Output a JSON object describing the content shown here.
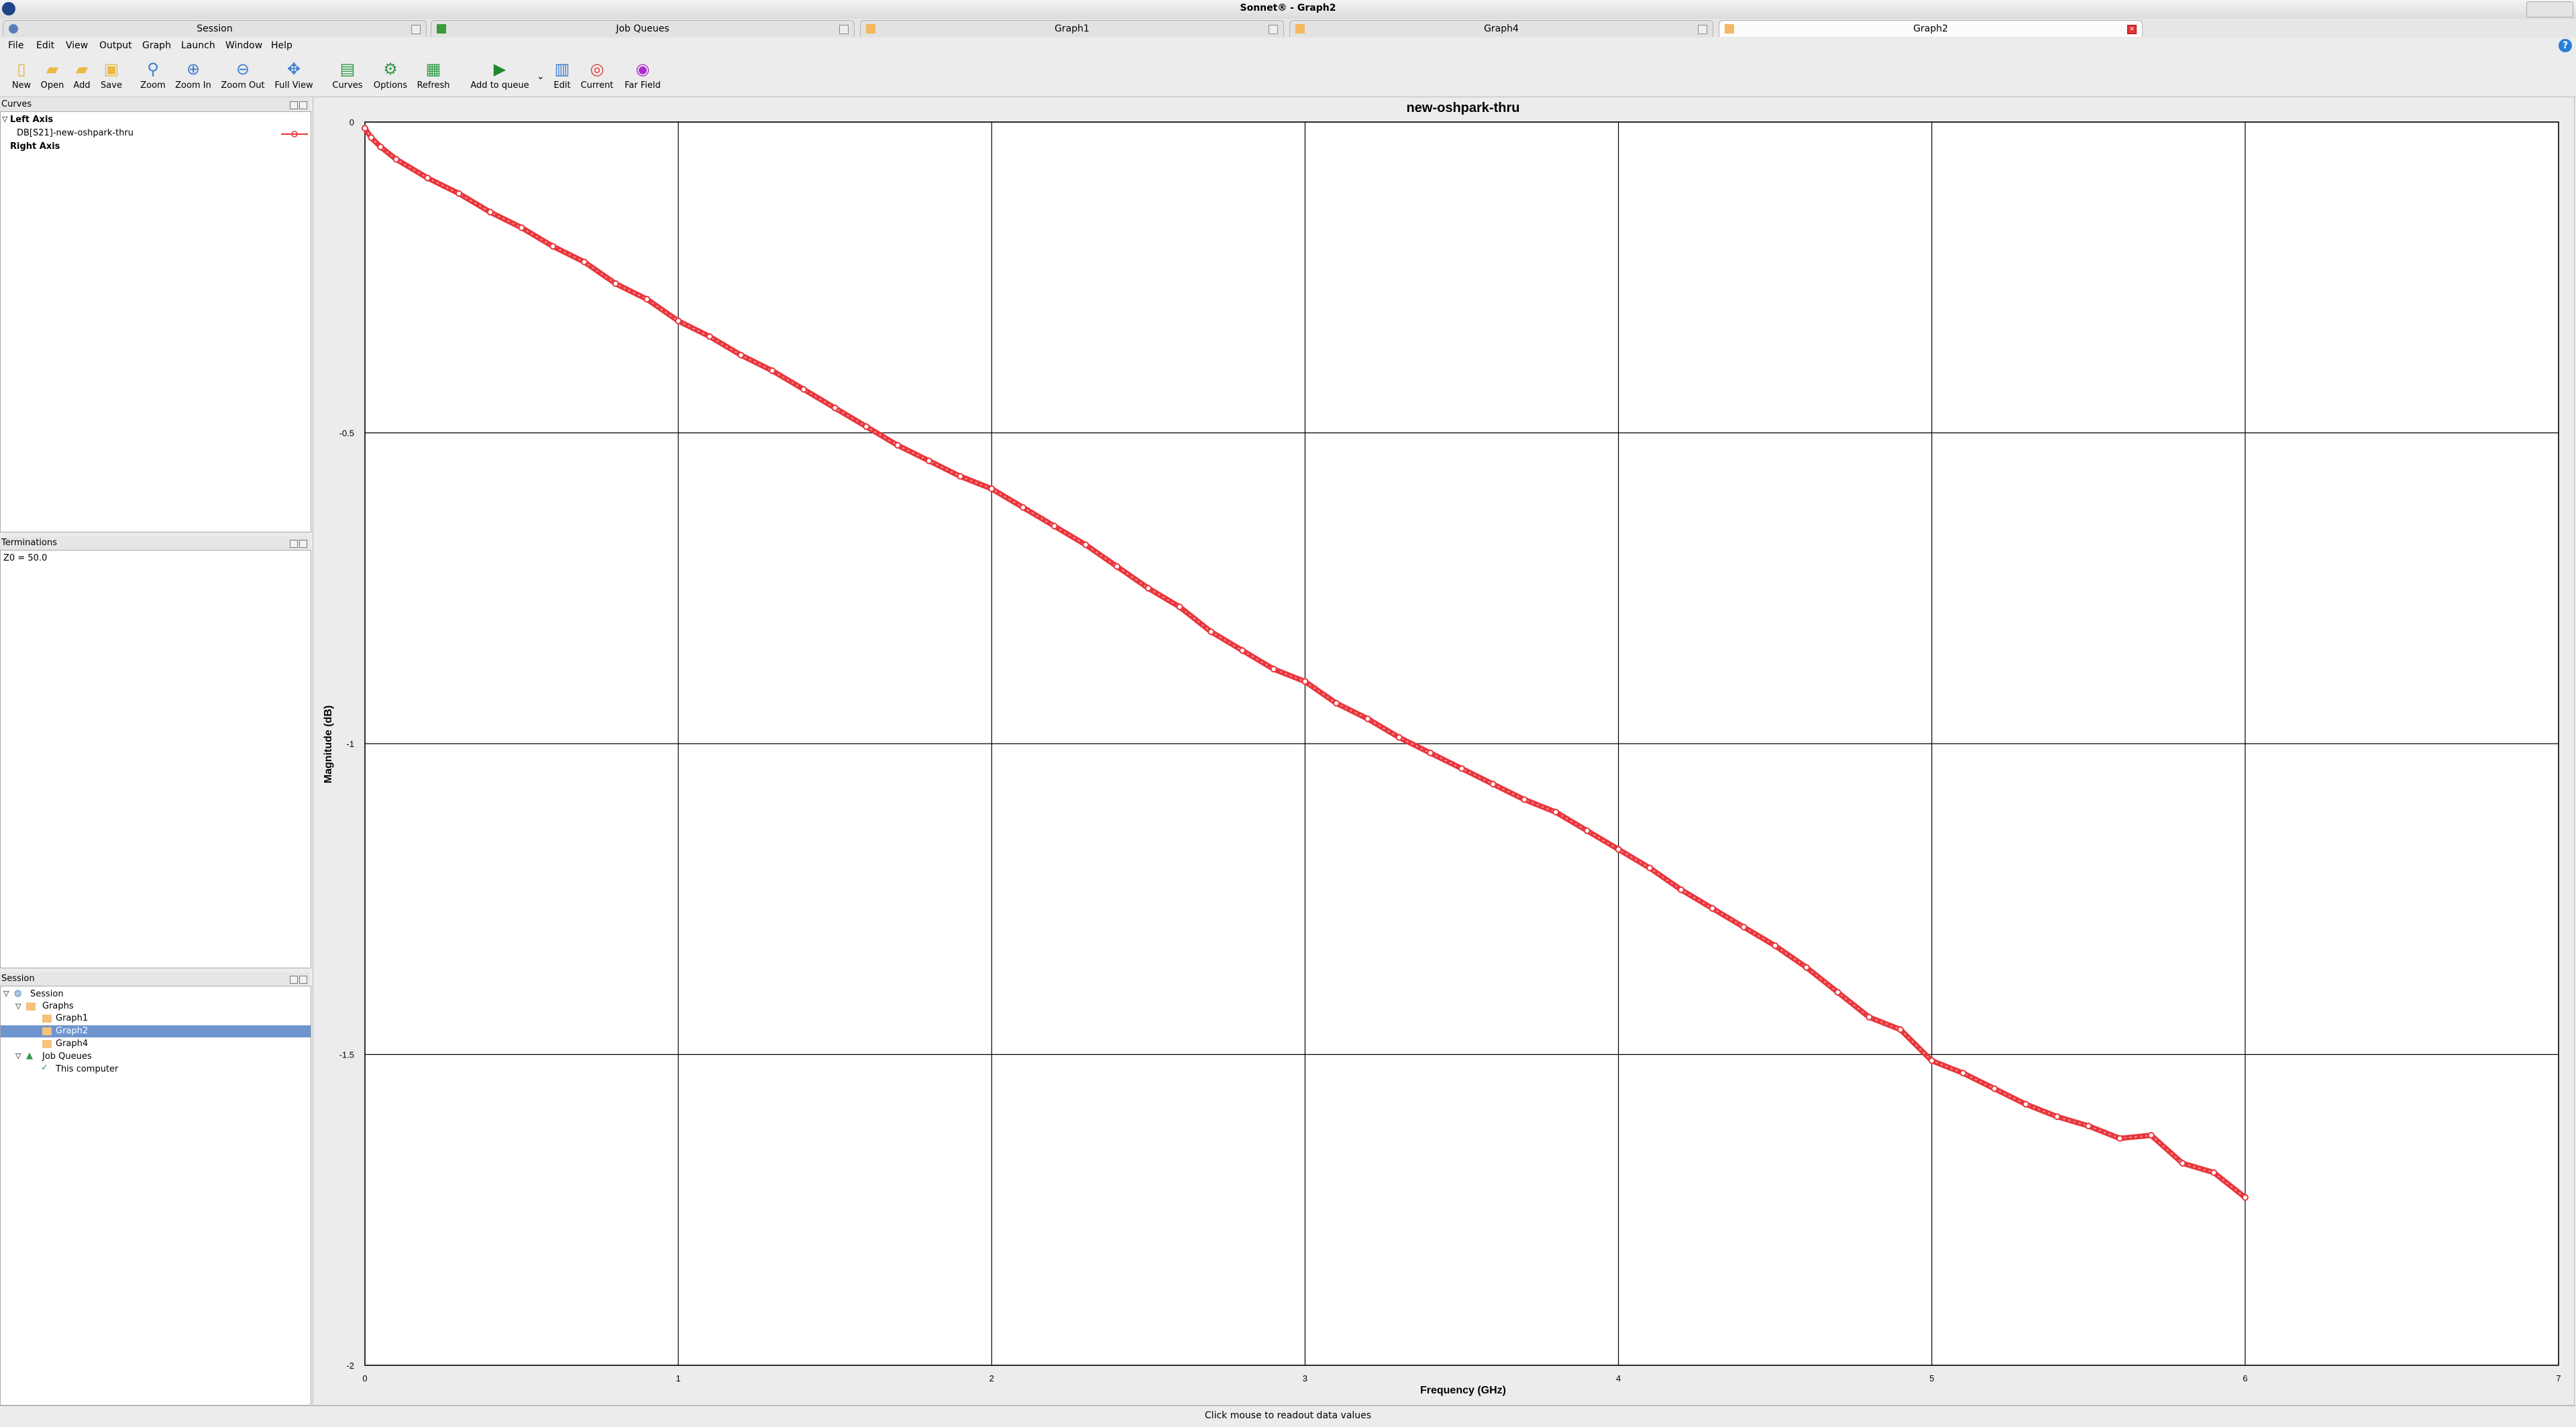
{
  "window": {
    "title": "Sonnet® - Graph2"
  },
  "tabs": [
    {
      "label": "Session"
    },
    {
      "label": "Job Queues"
    },
    {
      "label": "Graph1"
    },
    {
      "label": "Graph4"
    },
    {
      "label": "Graph2",
      "active": true
    }
  ],
  "menu": {
    "file": "File",
    "edit": "Edit",
    "view": "View",
    "output": "Output",
    "graph": "Graph",
    "launch": "Launch",
    "window": "Window",
    "help": "Help"
  },
  "toolbar": {
    "new": "New",
    "open": "Open",
    "add": "Add",
    "save": "Save",
    "zoom": "Zoom",
    "zoom_in": "Zoom In",
    "zoom_out": "Zoom Out",
    "full_view": "Full View",
    "curves": "Curves",
    "options": "Options",
    "refresh": "Refresh",
    "add_to_queue": "Add to queue",
    "edit": "Edit",
    "current": "Current",
    "far_field": "Far Field"
  },
  "curves_panel": {
    "title": "Curves",
    "left_axis": "Left Axis",
    "curve_name": "DB[S21]-new-oshpark-thru",
    "right_axis": "Right Axis"
  },
  "terminations_panel": {
    "title": "Terminations",
    "z0": "Z0 = 50.0"
  },
  "session_panel": {
    "title": "Session",
    "root": "Session",
    "graphs": "Graphs",
    "graph1": "Graph1",
    "graph2": "Graph2",
    "graph4": "Graph4",
    "job_queues": "Job Queues",
    "this_computer": "This computer"
  },
  "status": {
    "text": "Click mouse to readout data values"
  },
  "colors": {
    "curve": "#e8363c",
    "selection": "#6f95cf"
  },
  "chart_data": {
    "type": "line",
    "title": "new-oshpark-thru",
    "xlabel": "Frequency (GHz)",
    "ylabel": "Magnitude (dB)",
    "xlim": [
      0,
      7
    ],
    "ylim": [
      -2,
      0
    ],
    "xticks": [
      0,
      1,
      2,
      3,
      4,
      5,
      6,
      7
    ],
    "yticks": [
      0,
      -0.5,
      -1,
      -1.5,
      -2
    ],
    "grid": true,
    "series": [
      {
        "name": "DB[S21]-new-oshpark-thru",
        "color": "#e8363c",
        "x": [
          0,
          0.02,
          0.05,
          0.1,
          0.2,
          0.3,
          0.4,
          0.5,
          0.6,
          0.7,
          0.8,
          0.9,
          1.0,
          1.1,
          1.2,
          1.3,
          1.4,
          1.5,
          1.6,
          1.7,
          1.8,
          1.9,
          2.0,
          2.1,
          2.2,
          2.3,
          2.4,
          2.5,
          2.6,
          2.7,
          2.8,
          2.9,
          3.0,
          3.1,
          3.2,
          3.3,
          3.4,
          3.5,
          3.6,
          3.7,
          3.8,
          3.9,
          4.0,
          4.1,
          4.2,
          4.3,
          4.4,
          4.5,
          4.6,
          4.7,
          4.8,
          4.9,
          5.0,
          5.1,
          5.2,
          5.3,
          5.4,
          5.5,
          5.6,
          5.7,
          5.8,
          5.9,
          6.0
        ],
        "y": [
          -0.01,
          -0.025,
          -0.04,
          -0.06,
          -0.09,
          -0.115,
          -0.145,
          -0.17,
          -0.2,
          -0.225,
          -0.26,
          -0.285,
          -0.32,
          -0.345,
          -0.375,
          -0.4,
          -0.43,
          -0.46,
          -0.49,
          -0.52,
          -0.545,
          -0.57,
          -0.59,
          -0.62,
          -0.65,
          -0.68,
          -0.715,
          -0.75,
          -0.78,
          -0.82,
          -0.85,
          -0.88,
          -0.9,
          -0.935,
          -0.96,
          -0.99,
          -1.015,
          -1.04,
          -1.065,
          -1.09,
          -1.11,
          -1.14,
          -1.17,
          -1.2,
          -1.235,
          -1.265,
          -1.295,
          -1.325,
          -1.36,
          -1.4,
          -1.44,
          -1.46,
          -1.51,
          -1.53,
          -1.555,
          -1.58,
          -1.6,
          -1.615,
          -1.635,
          -1.63,
          -1.675,
          -1.69,
          -1.73
        ]
      }
    ]
  }
}
